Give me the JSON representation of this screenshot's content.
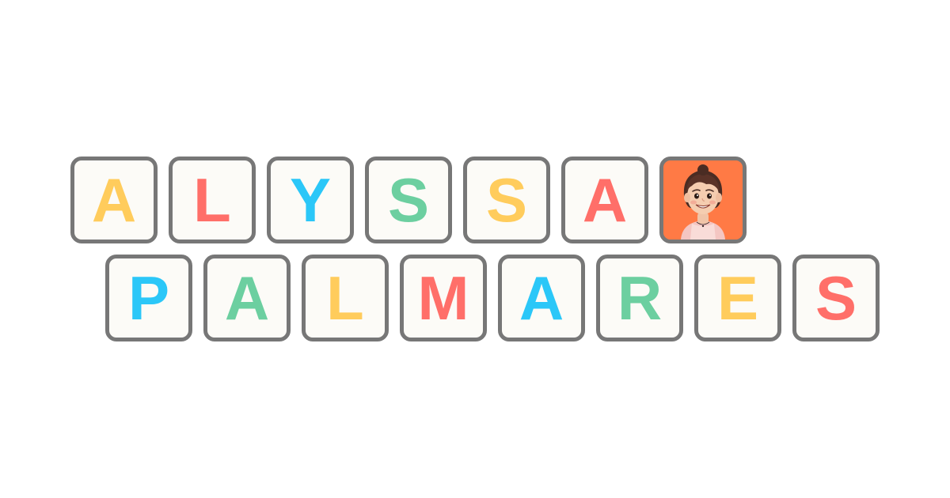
{
  "first_name": {
    "letters": [
      {
        "char": "A",
        "color": "#FFCC5C"
      },
      {
        "char": "L",
        "color": "#FF6F69"
      },
      {
        "char": "Y",
        "color": "#2BC7F8"
      },
      {
        "char": "S",
        "color": "#6CCFA0"
      },
      {
        "char": "S",
        "color": "#FFCC5C"
      },
      {
        "char": "A",
        "color": "#FF6F69"
      }
    ],
    "avatar": {
      "icon": "avatar-girl-icon",
      "background": "#FF7A45"
    }
  },
  "last_name": {
    "letters": [
      {
        "char": "P",
        "color": "#2BC7F8"
      },
      {
        "char": "A",
        "color": "#6CCFA0"
      },
      {
        "char": "L",
        "color": "#FFCC5C"
      },
      {
        "char": "M",
        "color": "#FF6F69"
      },
      {
        "char": "A",
        "color": "#2BC7F8"
      },
      {
        "char": "R",
        "color": "#6CCFA0"
      },
      {
        "char": "E",
        "color": "#FFCC5C"
      },
      {
        "char": "S",
        "color": "#FF6F69"
      }
    ]
  }
}
